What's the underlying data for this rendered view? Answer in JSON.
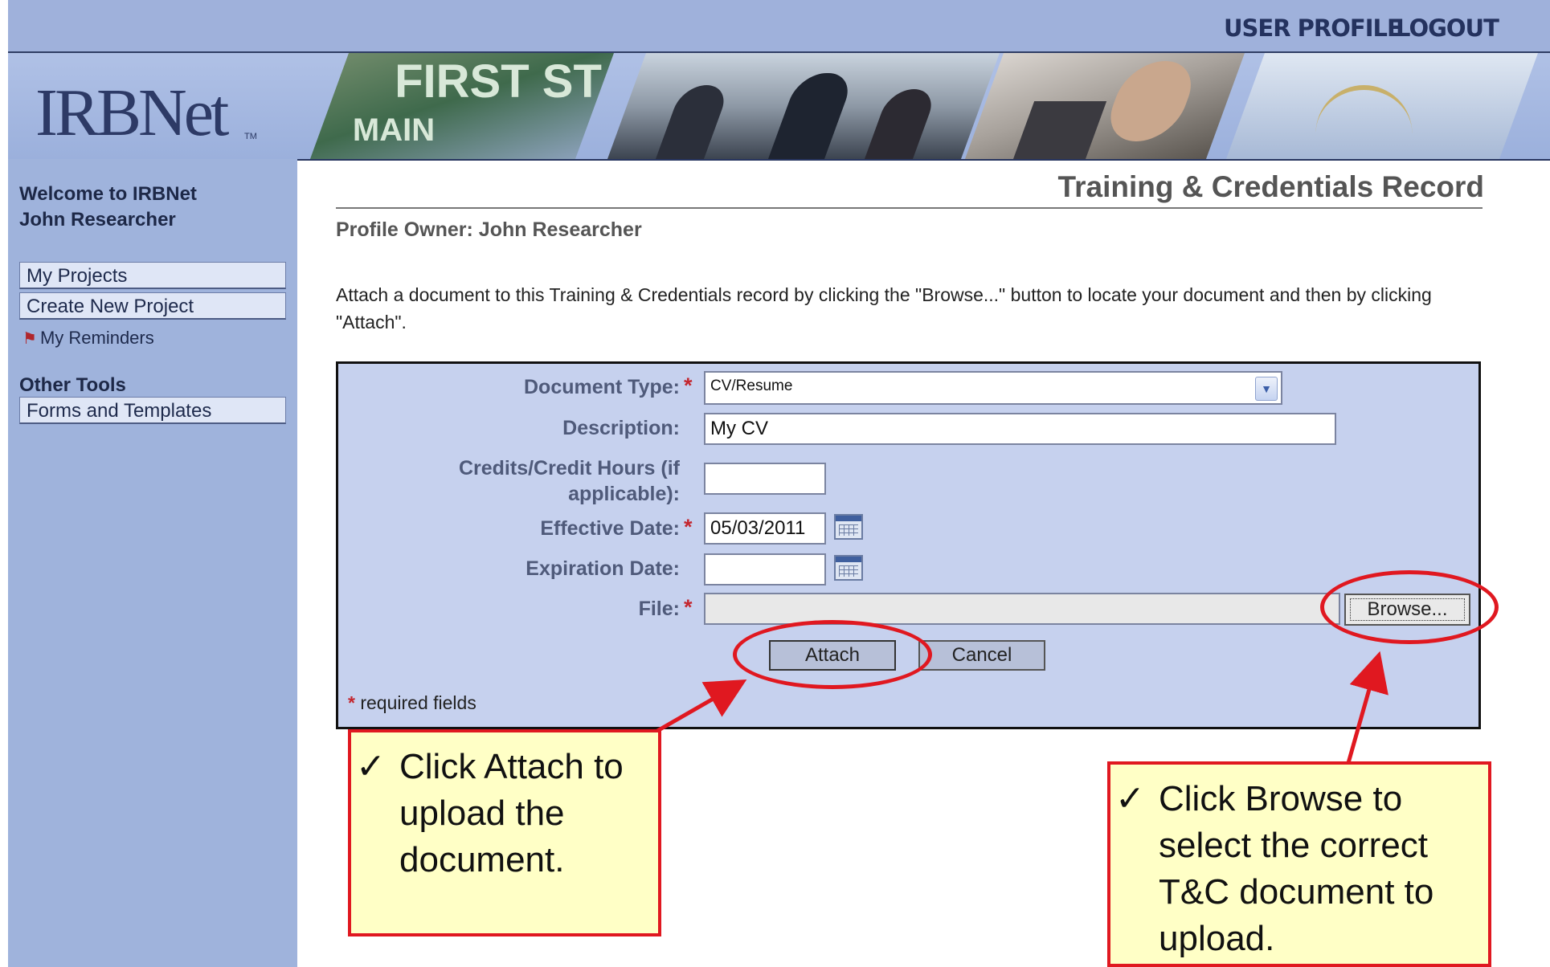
{
  "header": {
    "user_profile": "USER PROFILE",
    "logout": "LOGOUT",
    "logo_text": "IRBNet",
    "logo_tm": "TM"
  },
  "sidebar": {
    "welcome_line1": "Welcome to IRBNet",
    "welcome_line2": "John Researcher",
    "items": [
      {
        "label": "My Projects"
      },
      {
        "label": "Create New Project"
      }
    ],
    "reminders": "My Reminders",
    "other_tools_heading": "Other Tools",
    "tools": [
      {
        "label": "Forms and Templates"
      }
    ]
  },
  "main": {
    "title": "Training & Credentials Record",
    "profile_owner": "Profile Owner: John Researcher",
    "instruction": "Attach a document to this Training & Credentials record by clicking the \"Browse...\" button to locate your document and then by clicking \"Attach\"."
  },
  "form": {
    "document_type": {
      "label": "Document Type:",
      "value": "CV/Resume"
    },
    "description": {
      "label": "Description:",
      "value": "My CV"
    },
    "credits": {
      "label_line1": "Credits/Credit Hours (if",
      "label_line2": "applicable):",
      "value": ""
    },
    "effective_date": {
      "label": "Effective Date:",
      "value": "05/03/2011"
    },
    "expiration_date": {
      "label": "Expiration Date:",
      "value": ""
    },
    "file": {
      "label": "File:",
      "value": ""
    },
    "browse_label": "Browse...",
    "attach_label": "Attach",
    "cancel_label": "Cancel",
    "required_note": "required fields",
    "required_marker": "*"
  },
  "annotations": {
    "attach_callout": "Click Attach to upload the document.",
    "browse_callout": "Click Browse to select the correct T&C document to upload.",
    "check_mark": "✓"
  },
  "colors": {
    "accent_red": "#e01820",
    "callout_bg": "#ffffc6",
    "sidebar_bg": "#9fb3dc",
    "panel_bg": "#c6d1ee"
  }
}
